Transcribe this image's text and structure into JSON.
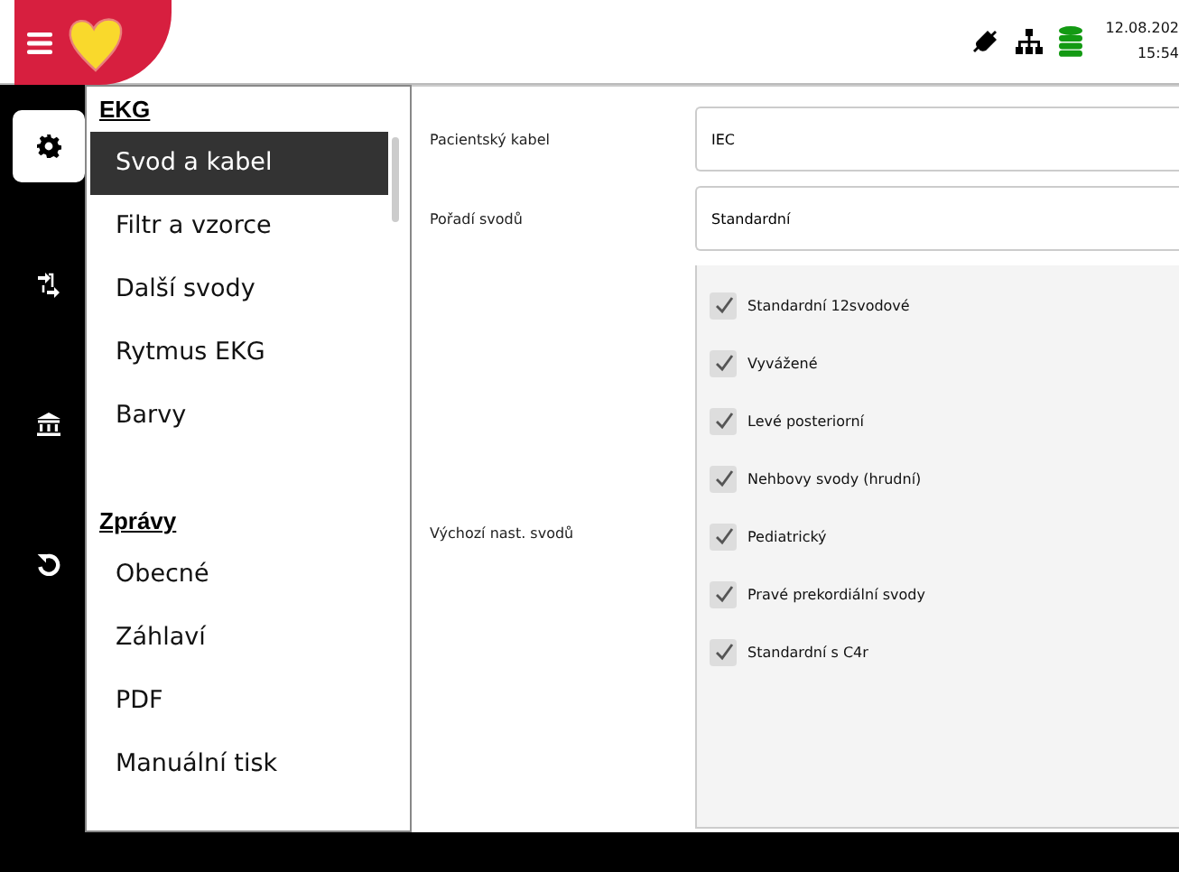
{
  "header": {
    "date": "12.08.202",
    "time": "15:54"
  },
  "rail": [
    {
      "kind": "settings",
      "selected": true
    },
    {
      "kind": "transfer",
      "selected": false
    },
    {
      "kind": "bank",
      "selected": false
    },
    {
      "kind": "undo",
      "selected": false
    }
  ],
  "menu": [
    {
      "heading": "EKG",
      "items": [
        {
          "label": "Svod a kabel",
          "selected": true
        },
        {
          "label": "Filtr a vzorce",
          "selected": false
        },
        {
          "label": "Další svody",
          "selected": false
        },
        {
          "label": "Rytmus EKG",
          "selected": false
        },
        {
          "label": "Barvy",
          "selected": false
        }
      ]
    },
    {
      "heading": "Zprávy",
      "items": [
        {
          "label": "Obecné",
          "selected": false
        },
        {
          "label": "Záhlaví",
          "selected": false
        },
        {
          "label": "PDF",
          "selected": false
        },
        {
          "label": "Manuální tisk",
          "selected": false
        }
      ]
    }
  ],
  "fields": [
    {
      "label": "Pacientský kabel",
      "value": "IEC"
    },
    {
      "label": "Pořadí svodů",
      "value": "Standardní"
    }
  ],
  "lead_defaults": {
    "label": "Výchozí nast. svodů",
    "options": [
      {
        "label": "Standardní 12svodové",
        "checked": true
      },
      {
        "label": "Vyvážené",
        "checked": true
      },
      {
        "label": "Levé posteriorní",
        "checked": true
      },
      {
        "label": "Nehbovy svody (hrudní)",
        "checked": true
      },
      {
        "label": "Pediatrický",
        "checked": true
      },
      {
        "label": "Pravé prekordiální svody",
        "checked": true
      },
      {
        "label": "Standardní s C4r",
        "checked": true
      }
    ]
  }
}
